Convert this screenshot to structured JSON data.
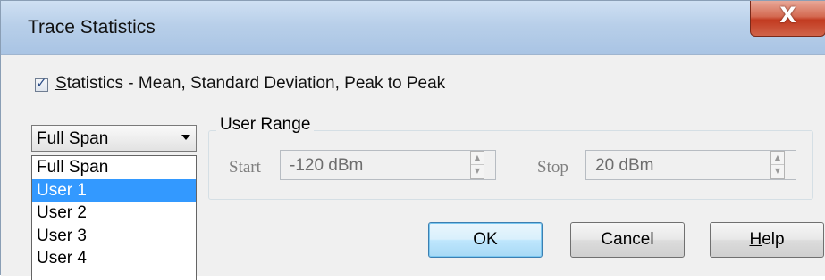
{
  "window": {
    "title": "Trace Statistics",
    "close_glyph": "X"
  },
  "statistics": {
    "checked": true,
    "check_glyph": "✓",
    "label_prefix": "S",
    "label_rest": "tatistics - Mean, Standard Deviation, Peak to Peak"
  },
  "range": {
    "selected_value": "Full Span",
    "options": [
      "Full Span",
      "User 1",
      "User 2",
      "User 3",
      "User 4"
    ],
    "highlighted_option": "User 1"
  },
  "user_range": {
    "group_label": "User Range",
    "start_label": "Start",
    "start_value": "-120 dBm",
    "stop_label": "Stop",
    "stop_value": "20 dBm"
  },
  "buttons": {
    "ok": "OK",
    "cancel": "Cancel",
    "help_prefix": "H",
    "help_rest": "elp"
  },
  "colors": {
    "selection": "#3399ff",
    "title_bar": "#b8cfe9",
    "close_button": "#c23a20"
  },
  "icons": {
    "close": "close-icon",
    "dropdown": "chevron-down-icon",
    "spinner_up": "spin-up-icon",
    "spinner_down": "spin-down-icon",
    "checkbox": "check-icon"
  }
}
